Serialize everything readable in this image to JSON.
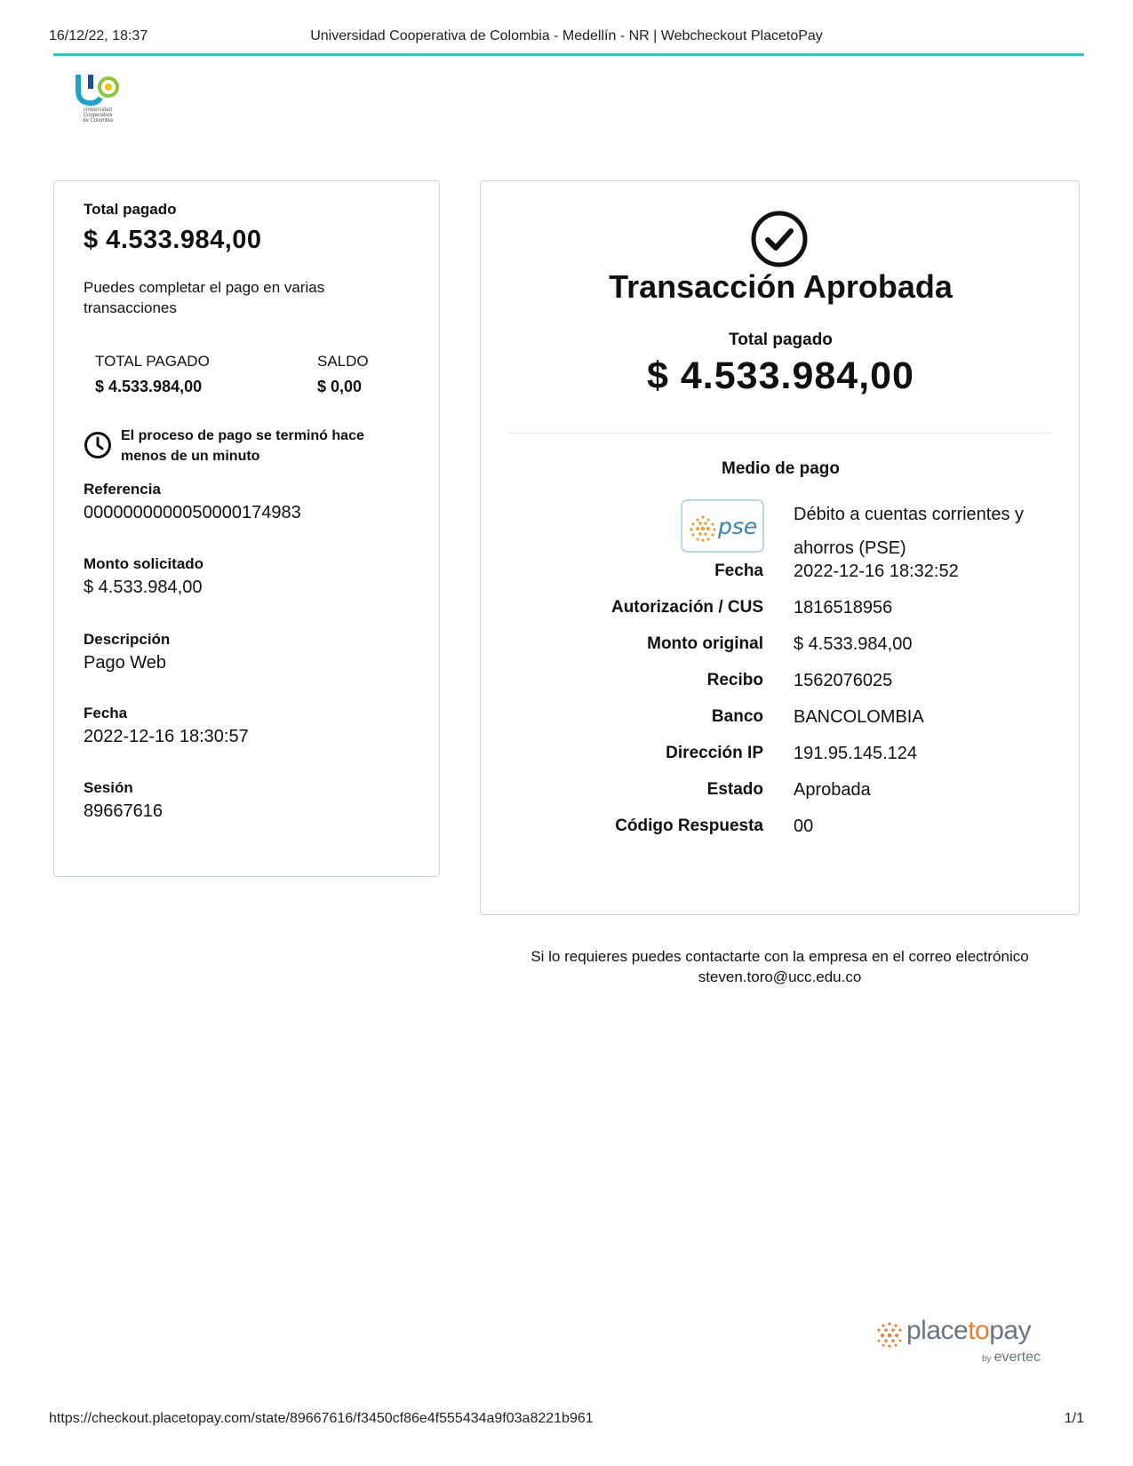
{
  "print_header": {
    "date": "16/12/22, 18:37",
    "title": "Universidad Cooperativa de Colombia - Medellín - NR | Webcheckout PlacetoPay"
  },
  "logo": {
    "text_line1": "Universidad Cooperativa",
    "text_line2": "de Colombia"
  },
  "summary": {
    "total_label": "Total pagado",
    "total_amount": "$ 4.533.984,00",
    "partial_text": "Puedes completar el pago en varias transacciones",
    "totals": [
      {
        "header": "TOTAL PAGADO",
        "value": "$ 4.533.984,00"
      },
      {
        "header": "SALDO",
        "value": "$ 0,00"
      }
    ],
    "process_text_line1": "El proceso de pago se terminó hace",
    "process_text_line2": "menos de un minuto",
    "fields": [
      {
        "label": "Referencia",
        "value": "0000000000050000174983"
      },
      {
        "label": "Monto solicitado",
        "value": "$ 4.533.984,00"
      },
      {
        "label": "Descripción",
        "value": "Pago Web"
      },
      {
        "label": "Fecha",
        "value": "2022-12-16 18:30:57"
      },
      {
        "label": "Sesión",
        "value": "89667616"
      }
    ]
  },
  "transaction": {
    "status_title": "Transacción Aprobada",
    "total_label": "Total pagado",
    "total_amount": "$ 4.533.984,00",
    "payment_method_label": "Medio de pago",
    "payment_method_logo": "PSE",
    "payment_method_line1": "Débito a cuentas corrientes y",
    "payment_method_line2": "ahorros (PSE)",
    "details": [
      {
        "label": "Fecha",
        "value": "2022-12-16 18:32:52"
      },
      {
        "label": "Autorización / CUS",
        "value": "1816518956"
      },
      {
        "label": "Monto original",
        "value": "$ 4.533.984,00"
      },
      {
        "label": "Recibo",
        "value": "1562076025"
      },
      {
        "label": "Banco",
        "value": "BANCOLOMBIA"
      },
      {
        "label": "Dirección IP",
        "value": "191.95.145.124"
      },
      {
        "label": "Estado",
        "value": "Aprobada"
      },
      {
        "label": "Código Respuesta",
        "value": "00"
      }
    ]
  },
  "contact": {
    "line1": "Si lo requieres puedes contactarte con la empresa en el correo electrónico",
    "email": "steven.toro@ucc.edu.co"
  },
  "brand": {
    "word_a": "place",
    "word_b": "to",
    "word_c": "pay",
    "by": "by",
    "evertec": "evertec"
  },
  "print_footer": {
    "url": "https://checkout.placetopay.com/state/89667616/f3450cf86e4f555434a9f03a8221b961",
    "page": "1/1"
  },
  "colors": {
    "accent_rule": "#3dbfbf",
    "card_border": "#c9d5de",
    "brand_orange": "#ee7c31"
  }
}
